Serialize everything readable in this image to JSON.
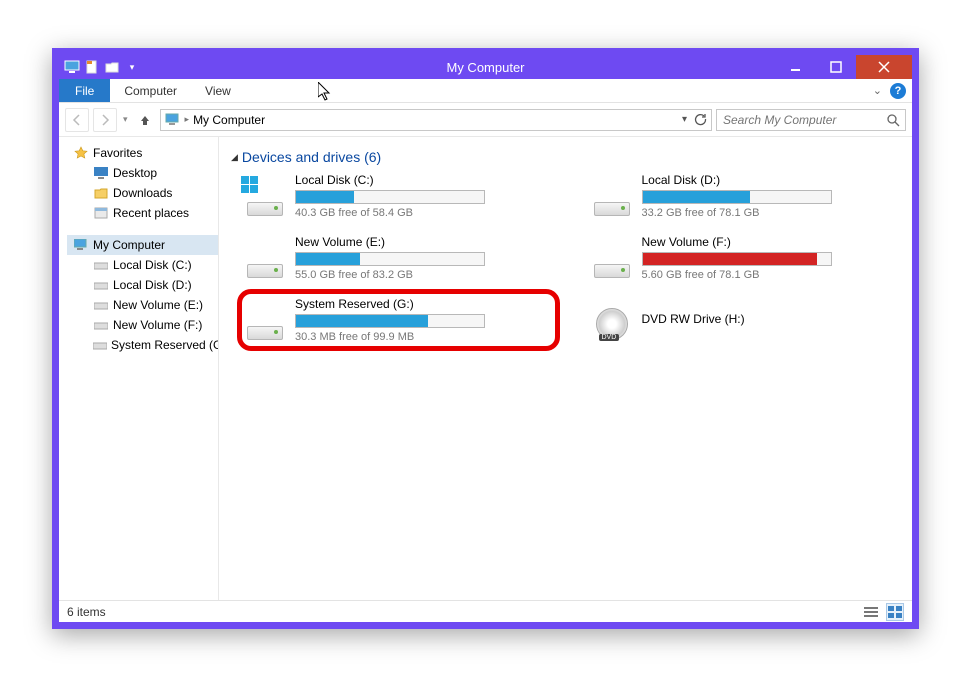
{
  "window": {
    "title": "My Computer"
  },
  "ribbon": {
    "file_tab": "File",
    "tabs": [
      "Computer",
      "View"
    ]
  },
  "addressbar": {
    "location": "My Computer",
    "search_placeholder": "Search My Computer"
  },
  "sidebar": {
    "favorites_label": "Favorites",
    "favorites": [
      {
        "label": "Desktop"
      },
      {
        "label": "Downloads"
      },
      {
        "label": "Recent places"
      }
    ],
    "computer_label": "My Computer",
    "drives": [
      {
        "label": "Local Disk (C:)"
      },
      {
        "label": "Local Disk (D:)"
      },
      {
        "label": "New Volume (E:)"
      },
      {
        "label": "New Volume (F:)"
      },
      {
        "label": "System Reserved (G:)"
      }
    ]
  },
  "content": {
    "group_header": "Devices and drives (6)",
    "drives": [
      {
        "name": "Local Disk (C:)",
        "free_text": "40.3 GB free of 58.4 GB",
        "fill_pct": 31,
        "color": "blue",
        "has_windows_badge": true
      },
      {
        "name": "Local Disk (D:)",
        "free_text": "33.2 GB free of 78.1 GB",
        "fill_pct": 57,
        "color": "blue"
      },
      {
        "name": "New Volume (E:)",
        "free_text": "55.0 GB free of 83.2 GB",
        "fill_pct": 34,
        "color": "blue"
      },
      {
        "name": "New Volume (F:)",
        "free_text": "5.60 GB free of 78.1 GB",
        "fill_pct": 93,
        "color": "red"
      },
      {
        "name": "System Reserved (G:)",
        "free_text": "30.3 MB free of 99.9 MB",
        "fill_pct": 70,
        "color": "blue",
        "highlighted": true
      },
      {
        "name": "DVD RW Drive (H:)",
        "icon": "dvd"
      }
    ]
  },
  "statusbar": {
    "text": "6 items"
  }
}
